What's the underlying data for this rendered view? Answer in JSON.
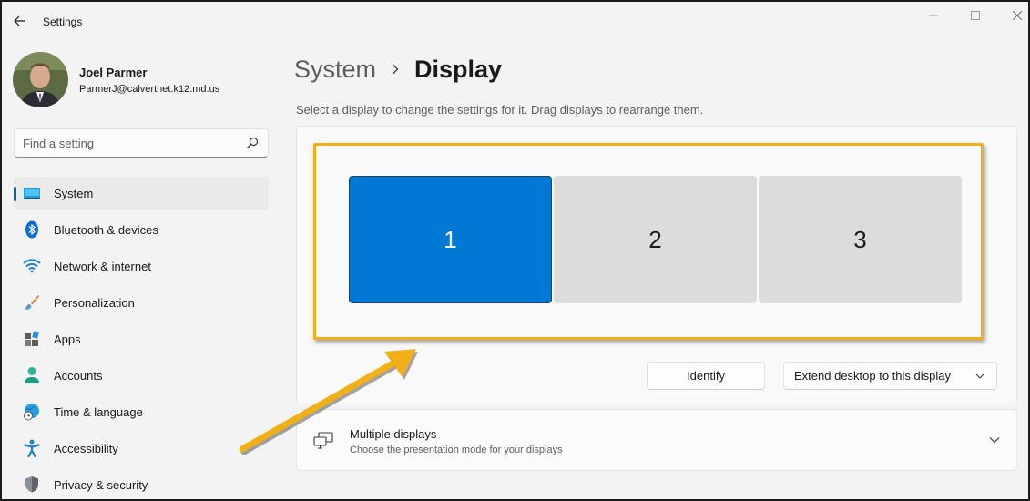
{
  "window": {
    "app_title": "Settings"
  },
  "profile": {
    "name": "Joel Parmer",
    "email": "ParmerJ@calvertnet.k12.md.us"
  },
  "search": {
    "placeholder": "Find a setting"
  },
  "nav": {
    "items": [
      {
        "label": "System",
        "icon": "monitor-icon",
        "active": true
      },
      {
        "label": "Bluetooth & devices",
        "icon": "bluetooth-icon"
      },
      {
        "label": "Network & internet",
        "icon": "wifi-icon"
      },
      {
        "label": "Personalization",
        "icon": "paintbrush-icon"
      },
      {
        "label": "Apps",
        "icon": "apps-icon"
      },
      {
        "label": "Accounts",
        "icon": "person-icon"
      },
      {
        "label": "Time & language",
        "icon": "globe-clock-icon"
      },
      {
        "label": "Accessibility",
        "icon": "accessibility-icon"
      },
      {
        "label": "Privacy & security",
        "icon": "shield-icon"
      }
    ]
  },
  "breadcrumb": {
    "parent": "System",
    "current": "Display"
  },
  "display": {
    "instruction": "Select a display to change the settings for it. Drag displays to rearrange them.",
    "monitors": [
      {
        "label": "1",
        "selected": true
      },
      {
        "label": "2",
        "selected": false
      },
      {
        "label": "3",
        "selected": false
      }
    ],
    "identify_label": "Identify",
    "mode_value": "Extend desktop to this display"
  },
  "multiple_displays": {
    "title": "Multiple displays",
    "subtitle": "Choose the presentation mode for your displays"
  },
  "colors": {
    "accent": "#0078d4",
    "annotation": "#f1b017"
  }
}
